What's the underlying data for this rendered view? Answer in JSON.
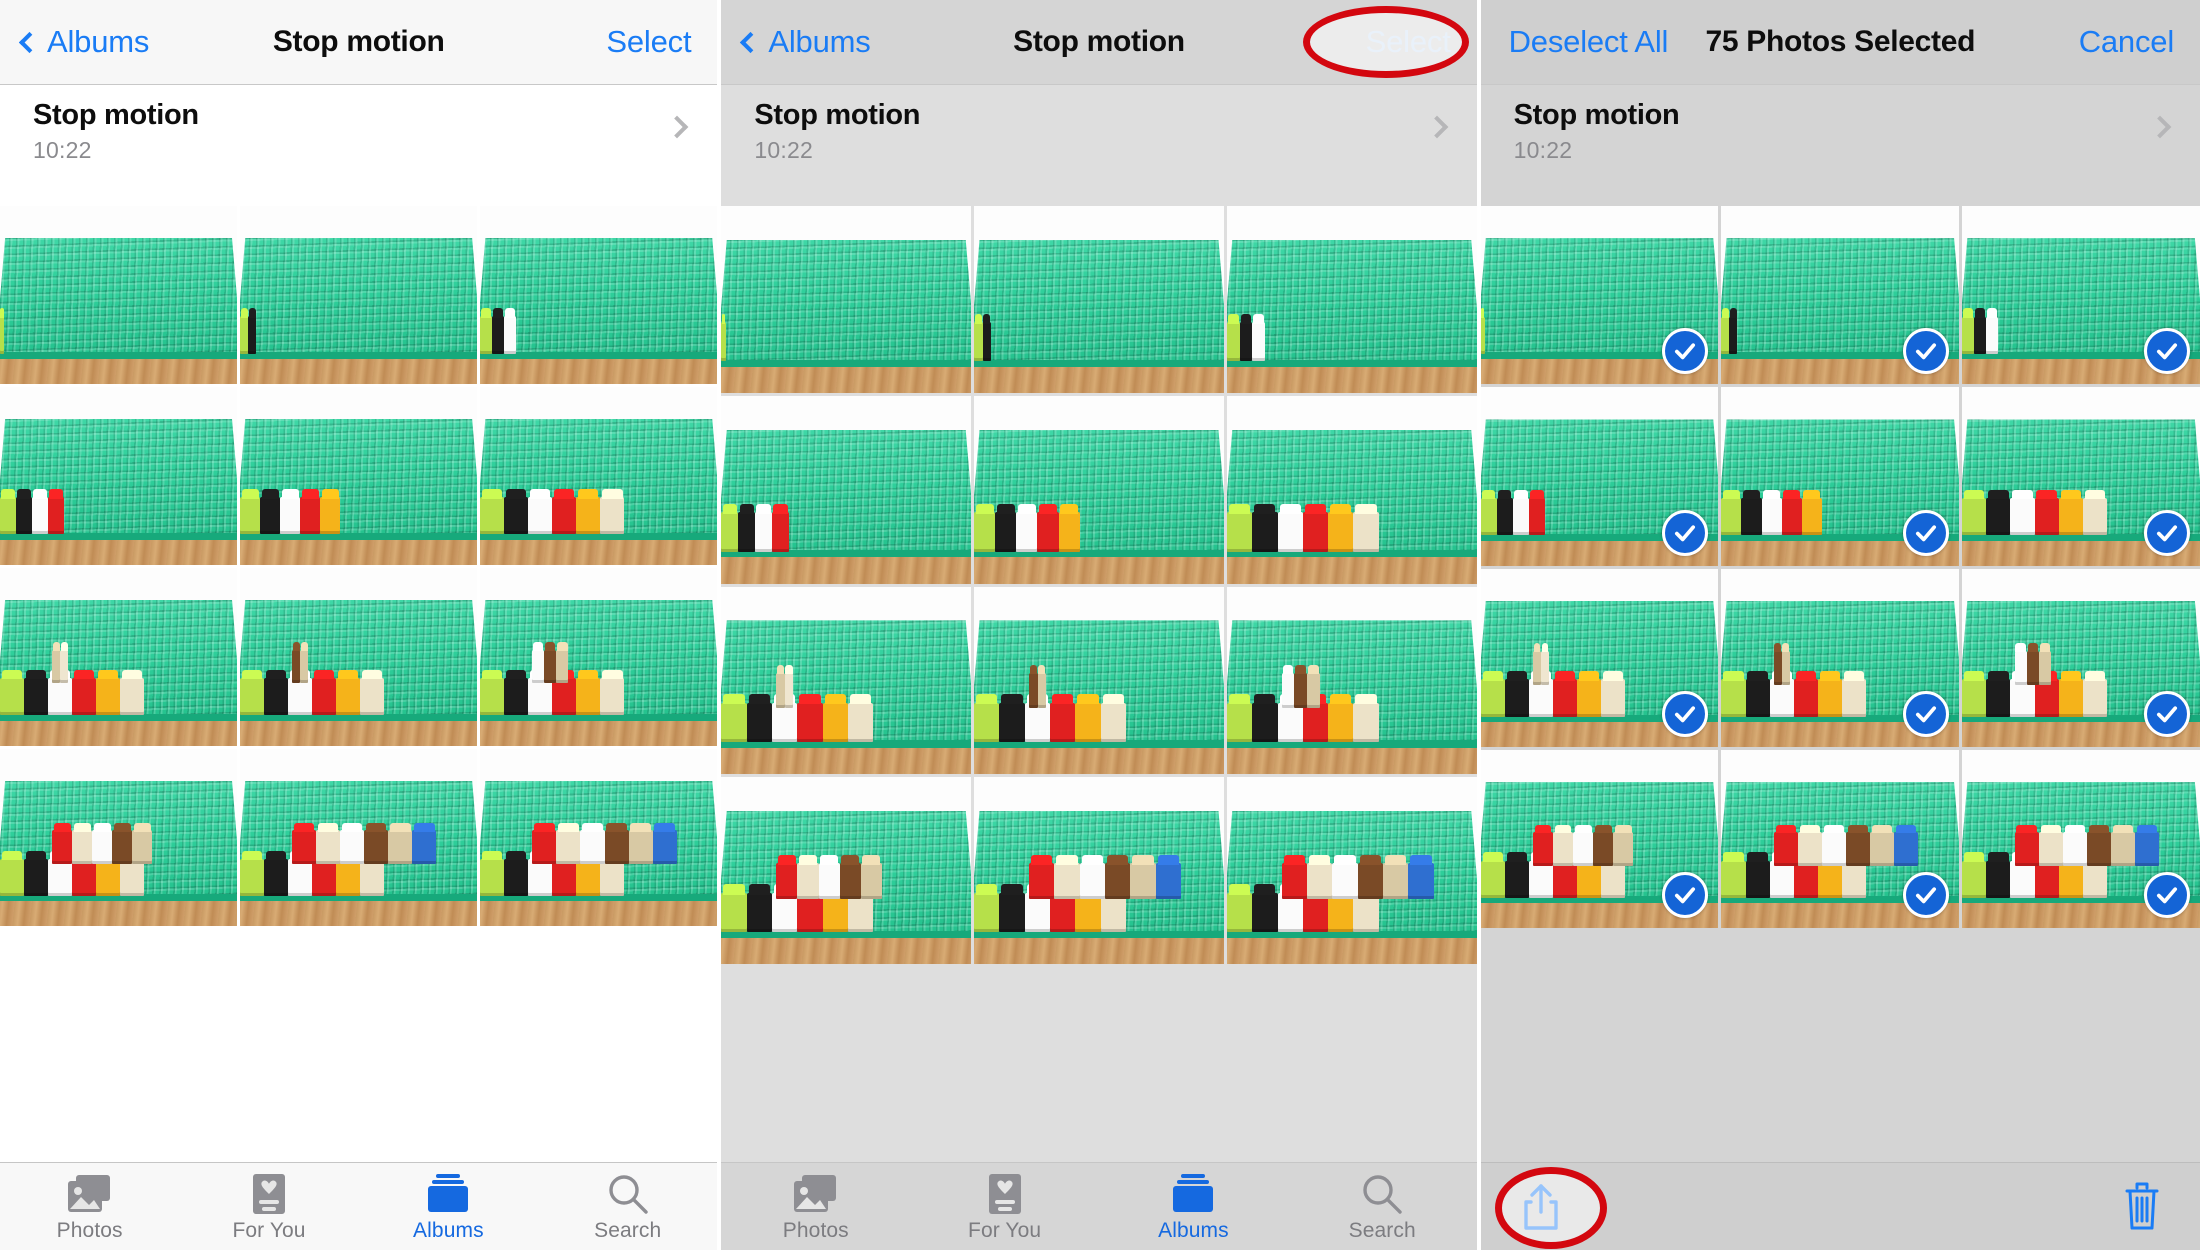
{
  "app": {
    "name": "Photos",
    "platform": "iOS"
  },
  "panels": [
    {
      "id": "panel-browse",
      "navbar": {
        "back_label": "Albums",
        "back_icon": "chevron-left-icon",
        "title": "Stop motion",
        "action_label": "Select",
        "action_state": "normal"
      },
      "album_header": {
        "name": "Stop motion",
        "time": "10:22",
        "disclosure_icon": "chevron-right-icon"
      },
      "selection_mode": false,
      "bottom_bar": "tabbar"
    },
    {
      "id": "panel-select-tapped",
      "navbar": {
        "back_label": "Albums",
        "back_icon": "chevron-left-icon",
        "title": "Stop motion",
        "action_label": "Select",
        "action_state": "pressed"
      },
      "album_header": {
        "name": "Stop motion",
        "time": "10:22",
        "disclosure_icon": "chevron-right-icon"
      },
      "selection_mode": false,
      "bottom_bar": "tabbar",
      "annotation": {
        "shape": "ellipse",
        "color": "#d3070f",
        "targets": "Select"
      }
    },
    {
      "id": "panel-selected",
      "navbar": {
        "left_label": "Deselect All",
        "title": "75 Photos Selected",
        "right_label": "Cancel"
      },
      "album_header": {
        "name": "Stop motion",
        "time": "10:22",
        "disclosure_icon": "chevron-right-icon"
      },
      "selection_mode": true,
      "bottom_bar": "actionbar",
      "annotation": {
        "shape": "ellipse",
        "color": "#d3070f",
        "targets": "share-button"
      }
    }
  ],
  "tabbar": {
    "items": [
      {
        "label": "Photos",
        "icon": "photos-icon",
        "active": false
      },
      {
        "label": "For You",
        "icon": "for-you-icon",
        "active": false
      },
      {
        "label": "Albums",
        "icon": "albums-icon",
        "active": true
      },
      {
        "label": "Search",
        "icon": "search-icon",
        "active": false
      }
    ],
    "active_color": "#1569e0",
    "inactive_color": "#7c7c80"
  },
  "actionbar": {
    "share_label": "Share",
    "share_icon": "share-up-arrow-icon",
    "delete_label": "Delete",
    "delete_icon": "trash-icon",
    "tint": "#1a7cf5"
  },
  "colors": {
    "tint_blue": "#1a7cf5",
    "check_blue": "#1464d6",
    "annotation_red": "#d3070f",
    "nav_bg_light": "#f7f7f7",
    "dimmed_overlay": "#dedede",
    "text_primary": "#0d0d0d",
    "text_secondary": "#8a8a8e"
  },
  "photo_grid": {
    "columns": 3,
    "selected_count": 75,
    "frames": [
      {
        "index": 1,
        "bricks_front": [
          "#b6e04a"
        ],
        "bricks_back": []
      },
      {
        "index": 2,
        "bricks_front": [
          "#b6e04a",
          "#1c1c1c"
        ],
        "bricks_back": []
      },
      {
        "index": 3,
        "bricks_front": [
          "#b6e04a",
          "#1c1c1c",
          "#fbfbfb"
        ],
        "bricks_back": []
      },
      {
        "index": 4,
        "bricks_front": [
          "#b6e04a",
          "#1c1c1c",
          "#fbfbfb",
          "#e02020"
        ],
        "bricks_back": []
      },
      {
        "index": 5,
        "bricks_front": [
          "#b6e04a",
          "#1c1c1c",
          "#fbfbfb",
          "#e02020",
          "#f5b31a"
        ],
        "bricks_back": []
      },
      {
        "index": 6,
        "bricks_front": [
          "#b6e04a",
          "#1c1c1c",
          "#fbfbfb",
          "#e02020",
          "#f5b31a",
          "#ece2c8"
        ],
        "bricks_back": []
      },
      {
        "index": 7,
        "bricks_front": [
          "#b6e04a",
          "#1c1c1c",
          "#fbfbfb",
          "#e02020",
          "#f5b31a",
          "#ece2c8"
        ],
        "bricks_back": [
          "#d8c9a4",
          "#efe6d0"
        ]
      },
      {
        "index": 8,
        "bricks_front": [
          "#b6e04a",
          "#1c1c1c",
          "#fbfbfb",
          "#e02020",
          "#f5b31a",
          "#ece2c8"
        ],
        "bricks_back": [
          "#7a4a26",
          "#d8c9a4"
        ]
      },
      {
        "index": 9,
        "bricks_front": [
          "#b6e04a",
          "#1c1c1c",
          "#fbfbfb",
          "#e02020",
          "#f5b31a",
          "#ece2c8"
        ],
        "bricks_back": [
          "#fbfbfb",
          "#7a4a26",
          "#d8c9a4"
        ]
      },
      {
        "index": 10,
        "bricks_front": [
          "#b6e04a",
          "#1c1c1c",
          "#fbfbfb",
          "#e02020",
          "#f5b31a",
          "#ece2c8"
        ],
        "bricks_back": [
          "#e02020",
          "#ece2c8",
          "#fbfbfb",
          "#7a4a26",
          "#d8c9a4"
        ]
      },
      {
        "index": 11,
        "bricks_front": [
          "#b6e04a",
          "#1c1c1c",
          "#fbfbfb",
          "#e02020",
          "#f5b31a",
          "#ece2c8"
        ],
        "bricks_back": [
          "#e02020",
          "#ece2c8",
          "#fbfbfb",
          "#7a4a26",
          "#d8c9a4",
          "#2f6fd0"
        ]
      },
      {
        "index": 12,
        "bricks_front": [
          "#b6e04a",
          "#1c1c1c",
          "#fbfbfb",
          "#e02020",
          "#f5b31a",
          "#ece2c8"
        ],
        "bricks_back": [
          "#e02020",
          "#ece2c8",
          "#fbfbfb",
          "#7a4a26",
          "#d8c9a4",
          "#2f6fd0"
        ]
      }
    ],
    "baseplate_color": "#2fcf9b",
    "table_color": "#c99a63",
    "check_icon": "checkmark-circle-icon"
  }
}
